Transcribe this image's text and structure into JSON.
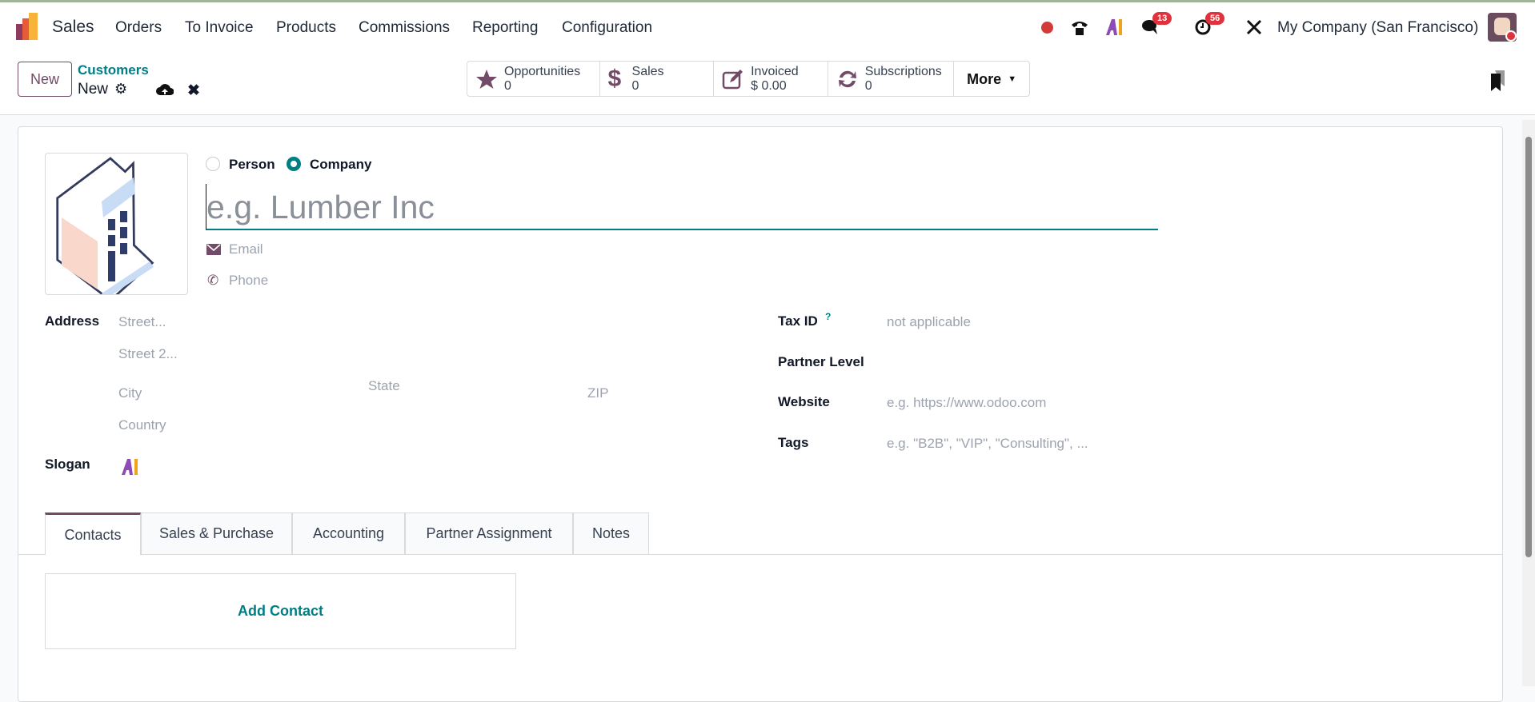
{
  "navbar": {
    "app_name": "Sales",
    "menu": [
      "Orders",
      "To Invoice",
      "Products",
      "Commissions",
      "Reporting",
      "Configuration"
    ],
    "chat_badge": "13",
    "activity_badge": "56",
    "company": "My Company (San Francisco)"
  },
  "control_panel": {
    "new_label": "New",
    "breadcrumb_parent": "Customers",
    "breadcrumb_current": "New",
    "stats": [
      {
        "label": "Opportunities",
        "value": "0"
      },
      {
        "label": "Sales",
        "value": "0"
      },
      {
        "label": "Invoiced",
        "value": "$ 0.00"
      },
      {
        "label": "Subscriptions",
        "value": "0"
      }
    ],
    "more_label": "More"
  },
  "form": {
    "type_person": "Person",
    "type_company": "Company",
    "selected_type": "Company",
    "name_placeholder": "e.g. Lumber Inc",
    "email_placeholder": "Email",
    "phone_placeholder": "Phone",
    "address_label": "Address",
    "street_placeholder": "Street...",
    "street2_placeholder": "Street 2...",
    "city_placeholder": "City",
    "state_placeholder": "State",
    "zip_placeholder": "ZIP",
    "country_placeholder": "Country",
    "slogan_label": "Slogan",
    "tax_id_label": "Tax ID",
    "tax_help": "?",
    "tax_id_placeholder": "not applicable",
    "partner_level_label": "Partner Level",
    "website_label": "Website",
    "website_placeholder": "e.g. https://www.odoo.com",
    "tags_label": "Tags",
    "tags_placeholder": "e.g. \"B2B\", \"VIP\", \"Consulting\", ..."
  },
  "tabs": [
    "Contacts",
    "Sales & Purchase",
    "Accounting",
    "Partner Assignment",
    "Notes"
  ],
  "contacts": {
    "add_label": "Add Contact"
  },
  "colors": {
    "brand": "#714b67",
    "accent": "#017e84"
  }
}
